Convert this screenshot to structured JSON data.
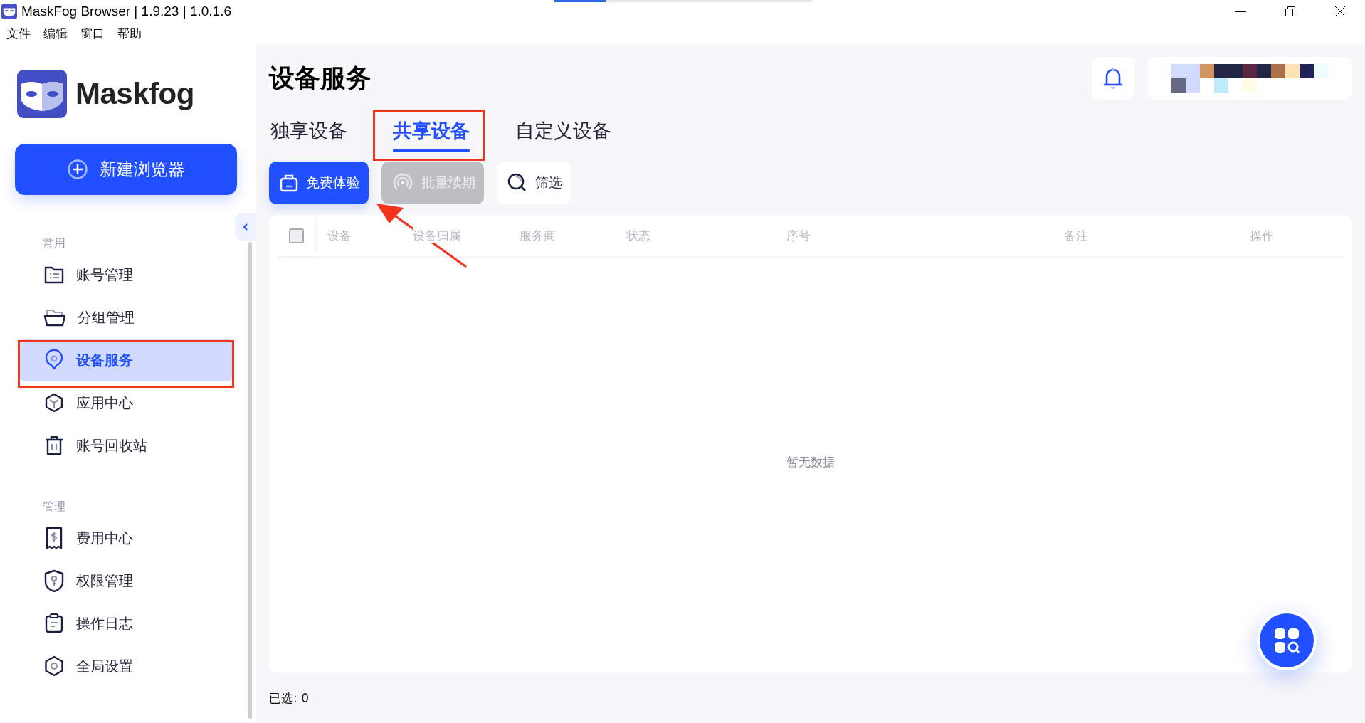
{
  "window": {
    "title": "MaskFog Browser | 1.9.23 | 1.0.1.6",
    "loading_bar": {
      "level": 0.2
    }
  },
  "menu": [
    "文件",
    "编辑",
    "窗口",
    "帮助"
  ],
  "sidebar": {
    "brand": "Maskfog",
    "new_button": "新建浏览器",
    "sections": [
      {
        "title": "常用",
        "items": [
          {
            "label": "账号管理",
            "selected": false
          },
          {
            "label": "分组管理",
            "selected": false
          },
          {
            "label": "设备服务",
            "selected": true
          },
          {
            "label": "应用中心",
            "selected": false
          },
          {
            "label": "账号回收站",
            "selected": false
          }
        ]
      },
      {
        "title": "管理",
        "items": [
          {
            "label": "费用中心",
            "selected": false
          },
          {
            "label": "权限管理",
            "selected": false
          },
          {
            "label": "操作日志",
            "selected": false
          },
          {
            "label": "全局设置",
            "selected": false
          }
        ]
      }
    ]
  },
  "page": {
    "title": "设备服务",
    "tabs": [
      {
        "label": "独享设备",
        "selected": false
      },
      {
        "label": "共享设备",
        "selected": true
      },
      {
        "label": "自定义设备",
        "selected": false
      }
    ],
    "toolbar": [
      {
        "label": "免费体验",
        "kind": "primary",
        "disabled": false
      },
      {
        "label": "批量续期",
        "kind": "primary",
        "disabled": true
      },
      {
        "label": "筛选",
        "kind": "plain",
        "disabled": false
      }
    ],
    "table": {
      "select_all": {
        "checked": false
      },
      "columns": [
        "设备",
        "设备归属",
        "服务商",
        "状态",
        "序号",
        "备注",
        "操作"
      ],
      "empty_text": "暂无数据"
    },
    "footer": "已选: 0"
  }
}
